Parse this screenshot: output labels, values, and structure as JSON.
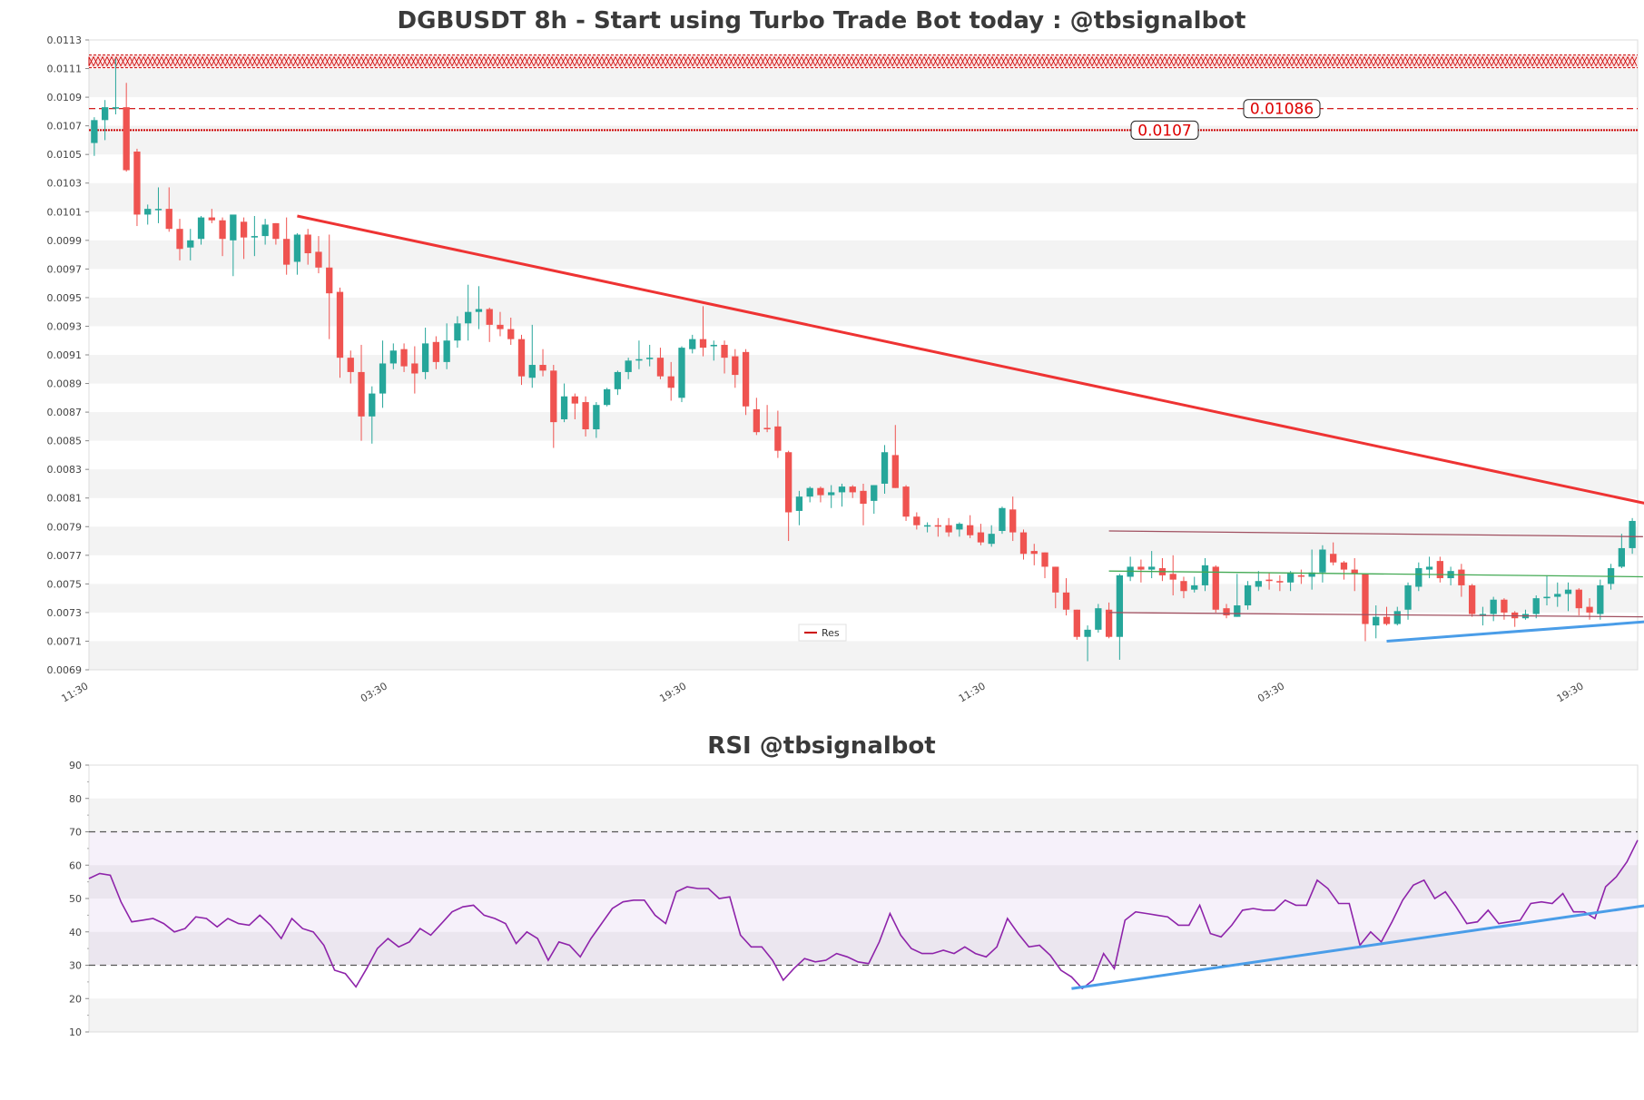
{
  "chart_data": [
    {
      "type": "candlestick",
      "title": "DGBUSDT 8h - Start using Turbo Trade Bot today : @tbsignalbot",
      "ylim": [
        0.0069,
        0.0113
      ],
      "yticks": [
        "0.0069",
        "0.0071",
        "0.0073",
        "0.0075",
        "0.0077",
        "0.0079",
        "0.0081",
        "0.0083",
        "0.0085",
        "0.0087",
        "0.0089",
        "0.0091",
        "0.0093",
        "0.0095",
        "0.0097",
        "0.0099",
        "0.0101",
        "0.0103",
        "0.0105",
        "0.0107",
        "0.0109",
        "0.0111",
        "0.0113"
      ],
      "xticks": [
        {
          "label": "11:30",
          "i": 0
        },
        {
          "label": "03:30",
          "i": 28
        },
        {
          "label": "19:30",
          "i": 56
        },
        {
          "label": "11:30",
          "i": 84
        },
        {
          "label": "03:30",
          "i": 112
        },
        {
          "label": "19:30",
          "i": 140
        }
      ],
      "candles": [
        [
          0.01058,
          0.01074,
          0.01049,
          0.01076
        ],
        [
          0.01074,
          0.01083,
          0.0106,
          0.01088
        ],
        [
          0.01082,
          0.01083,
          0.01078,
          0.01117
        ],
        [
          0.01083,
          0.01039,
          0.01038,
          0.011
        ],
        [
          0.01052,
          0.01008,
          0.01,
          0.01054
        ],
        [
          0.01008,
          0.01012,
          0.01001,
          0.01015
        ],
        [
          0.01012,
          0.01012,
          0.01002,
          0.01027
        ],
        [
          0.01012,
          0.00998,
          0.00996,
          0.01027
        ],
        [
          0.00998,
          0.00984,
          0.00976,
          0.01005
        ],
        [
          0.00985,
          0.0099,
          0.00976,
          0.00998
        ],
        [
          0.00991,
          0.01006,
          0.00987,
          0.01007
        ],
        [
          0.01006,
          0.01004,
          0.01002,
          0.01012
        ],
        [
          0.01004,
          0.00991,
          0.00979,
          0.01006
        ],
        [
          0.0099,
          0.01008,
          0.00965,
          0.01006
        ],
        [
          0.01003,
          0.00992,
          0.00977,
          0.01006
        ],
        [
          0.00992,
          0.00993,
          0.00979,
          0.01007
        ],
        [
          0.00993,
          0.01001,
          0.00987,
          0.01005
        ],
        [
          0.01002,
          0.00991,
          0.00987,
          0.01002
        ],
        [
          0.00991,
          0.00973,
          0.00966,
          0.01006
        ],
        [
          0.00975,
          0.00994,
          0.00966,
          0.00995
        ],
        [
          0.00994,
          0.00981,
          0.00973,
          0.00998
        ],
        [
          0.00982,
          0.00971,
          0.00967,
          0.00993
        ],
        [
          0.00971,
          0.00953,
          0.00921,
          0.00994
        ],
        [
          0.00954,
          0.00908,
          0.00894,
          0.00957
        ],
        [
          0.00908,
          0.00898,
          0.0089,
          0.00913
        ],
        [
          0.00898,
          0.00867,
          0.0085,
          0.00917
        ],
        [
          0.00867,
          0.00883,
          0.00848,
          0.00888
        ],
        [
          0.00883,
          0.00904,
          0.00873,
          0.0092
        ],
        [
          0.00904,
          0.00913,
          0.009,
          0.00918
        ],
        [
          0.00914,
          0.00902,
          0.00898,
          0.00918
        ],
        [
          0.00904,
          0.00897,
          0.00883,
          0.00916
        ],
        [
          0.00898,
          0.00918,
          0.00893,
          0.00929
        ],
        [
          0.00919,
          0.00905,
          0.009,
          0.00923
        ],
        [
          0.00905,
          0.0092,
          0.009,
          0.00932
        ],
        [
          0.0092,
          0.00932,
          0.00915,
          0.00937
        ],
        [
          0.00932,
          0.0094,
          0.0092,
          0.00959
        ],
        [
          0.0094,
          0.00942,
          0.00928,
          0.00958
        ],
        [
          0.00942,
          0.00931,
          0.00919,
          0.00943
        ],
        [
          0.00931,
          0.00928,
          0.00923,
          0.0094
        ],
        [
          0.00928,
          0.00921,
          0.00917,
          0.00936
        ],
        [
          0.00921,
          0.00895,
          0.00889,
          0.00924
        ],
        [
          0.00894,
          0.00903,
          0.00887,
          0.00931
        ],
        [
          0.00903,
          0.00899,
          0.00895,
          0.00914
        ],
        [
          0.00899,
          0.00863,
          0.00845,
          0.00903
        ],
        [
          0.00865,
          0.00881,
          0.00863,
          0.0089
        ],
        [
          0.00881,
          0.00876,
          0.00865,
          0.00883
        ],
        [
          0.00877,
          0.00858,
          0.00853,
          0.00881
        ],
        [
          0.00858,
          0.00875,
          0.00852,
          0.00877
        ],
        [
          0.00875,
          0.00886,
          0.00874,
          0.00887
        ],
        [
          0.00886,
          0.00898,
          0.00882,
          0.00899
        ],
        [
          0.00898,
          0.00906,
          0.00893,
          0.00908
        ],
        [
          0.00906,
          0.00907,
          0.009,
          0.0092
        ],
        [
          0.00907,
          0.00908,
          0.00902,
          0.00917
        ],
        [
          0.00908,
          0.00895,
          0.00893,
          0.00915
        ],
        [
          0.00895,
          0.00887,
          0.00878,
          0.00905
        ],
        [
          0.0088,
          0.00915,
          0.00877,
          0.00916
        ],
        [
          0.00914,
          0.00921,
          0.00911,
          0.00924
        ],
        [
          0.00921,
          0.00915,
          0.00909,
          0.00944
        ],
        [
          0.00916,
          0.00917,
          0.00906,
          0.0092
        ],
        [
          0.00917,
          0.00908,
          0.00897,
          0.0092
        ],
        [
          0.00909,
          0.00896,
          0.00887,
          0.00914
        ],
        [
          0.00912,
          0.00874,
          0.00868,
          0.00914
        ],
        [
          0.00872,
          0.00856,
          0.00854,
          0.0088
        ],
        [
          0.00859,
          0.00858,
          0.00856,
          0.00875
        ],
        [
          0.0086,
          0.00843,
          0.00838,
          0.00871
        ],
        [
          0.00842,
          0.008,
          0.0078,
          0.00843
        ],
        [
          0.00801,
          0.00811,
          0.00791,
          0.00815
        ],
        [
          0.00811,
          0.00817,
          0.00807,
          0.00818
        ],
        [
          0.00817,
          0.00812,
          0.00807,
          0.00818
        ],
        [
          0.00812,
          0.00814,
          0.00803,
          0.00819
        ],
        [
          0.00814,
          0.00818,
          0.00804,
          0.0082
        ],
        [
          0.00818,
          0.00814,
          0.0081,
          0.00819
        ],
        [
          0.00815,
          0.00806,
          0.00791,
          0.0082
        ],
        [
          0.00808,
          0.00819,
          0.00799,
          0.00819
        ],
        [
          0.0082,
          0.00842,
          0.00813,
          0.00847
        ],
        [
          0.0084,
          0.00817,
          0.00817,
          0.00861
        ],
        [
          0.00818,
          0.00797,
          0.00794,
          0.00819
        ],
        [
          0.00797,
          0.00791,
          0.00788,
          0.008
        ],
        [
          0.00791,
          0.00791,
          0.00786,
          0.00793
        ],
        [
          0.00791,
          0.0079,
          0.00783,
          0.00796
        ],
        [
          0.00791,
          0.00786,
          0.00783,
          0.00796
        ],
        [
          0.00788,
          0.00792,
          0.00783,
          0.00793
        ],
        [
          0.00791,
          0.00784,
          0.00782,
          0.00798
        ],
        [
          0.00786,
          0.00779,
          0.00777,
          0.00792
        ],
        [
          0.00778,
          0.00785,
          0.00776,
          0.00791
        ],
        [
          0.00787,
          0.00803,
          0.00785,
          0.00804
        ],
        [
          0.00802,
          0.00786,
          0.0078,
          0.00811
        ],
        [
          0.00786,
          0.00771,
          0.00767,
          0.00788
        ],
        [
          0.00773,
          0.00771,
          0.00763,
          0.00778
        ],
        [
          0.00772,
          0.00762,
          0.00754,
          0.00772
        ],
        [
          0.00762,
          0.00744,
          0.00733,
          0.00762
        ],
        [
          0.00744,
          0.00732,
          0.00728,
          0.00754
        ],
        [
          0.00732,
          0.00713,
          0.00711,
          0.00732
        ],
        [
          0.00713,
          0.00718,
          0.00696,
          0.00721
        ],
        [
          0.00718,
          0.00733,
          0.00716,
          0.00736
        ],
        [
          0.00732,
          0.00713,
          0.00712,
          0.00737
        ],
        [
          0.00713,
          0.00756,
          0.00697,
          0.00757
        ],
        [
          0.00755,
          0.00762,
          0.00752,
          0.00769
        ],
        [
          0.00762,
          0.0076,
          0.00751,
          0.00767
        ],
        [
          0.0076,
          0.00762,
          0.00754,
          0.00773
        ],
        [
          0.00761,
          0.00756,
          0.00752,
          0.00768
        ],
        [
          0.00757,
          0.00753,
          0.00742,
          0.0077
        ],
        [
          0.00752,
          0.00745,
          0.0074,
          0.00755
        ],
        [
          0.00746,
          0.00749,
          0.00744,
          0.00755
        ],
        [
          0.00749,
          0.00763,
          0.00745,
          0.00768
        ],
        [
          0.00762,
          0.00732,
          0.0073,
          0.00763
        ],
        [
          0.00733,
          0.00728,
          0.00726,
          0.00736
        ],
        [
          0.00727,
          0.00735,
          0.00727,
          0.00757
        ],
        [
          0.00735,
          0.00749,
          0.00732,
          0.00752
        ],
        [
          0.00748,
          0.00752,
          0.00745,
          0.00759
        ],
        [
          0.00753,
          0.00752,
          0.00746,
          0.00758
        ],
        [
          0.00752,
          0.00751,
          0.00745,
          0.00756
        ],
        [
          0.00751,
          0.00758,
          0.00745,
          0.00759
        ],
        [
          0.00756,
          0.00755,
          0.0075,
          0.0076
        ],
        [
          0.00755,
          0.00758,
          0.00746,
          0.00774
        ],
        [
          0.00758,
          0.00774,
          0.00751,
          0.00777
        ],
        [
          0.00771,
          0.00765,
          0.00763,
          0.00779
        ],
        [
          0.00765,
          0.0076,
          0.00753,
          0.00766
        ],
        [
          0.0076,
          0.00757,
          0.00745,
          0.00768
        ],
        [
          0.00757,
          0.00722,
          0.0071,
          0.00757
        ],
        [
          0.00721,
          0.00727,
          0.00712,
          0.00735
        ],
        [
          0.00727,
          0.00722,
          0.00721,
          0.00734
        ],
        [
          0.00722,
          0.00731,
          0.00721,
          0.00734
        ],
        [
          0.00732,
          0.00749,
          0.00725,
          0.00751
        ],
        [
          0.00748,
          0.00761,
          0.00745,
          0.00765
        ],
        [
          0.0076,
          0.00762,
          0.00754,
          0.00769
        ],
        [
          0.00766,
          0.00754,
          0.00751,
          0.00769
        ],
        [
          0.00754,
          0.00759,
          0.00749,
          0.00762
        ],
        [
          0.0076,
          0.00749,
          0.00741,
          0.00764
        ],
        [
          0.00749,
          0.00729,
          0.00727,
          0.0075
        ],
        [
          0.00729,
          0.00729,
          0.00721,
          0.00734
        ],
        [
          0.00729,
          0.00739,
          0.00724,
          0.00741
        ],
        [
          0.00739,
          0.0073,
          0.00725,
          0.0074
        ],
        [
          0.0073,
          0.00726,
          0.0072,
          0.00731
        ],
        [
          0.00726,
          0.00729,
          0.00725,
          0.00732
        ],
        [
          0.00729,
          0.0074,
          0.00726,
          0.00742
        ],
        [
          0.0074,
          0.00741,
          0.00735,
          0.00756
        ],
        [
          0.00741,
          0.00743,
          0.00734,
          0.00751
        ],
        [
          0.00743,
          0.00746,
          0.00731,
          0.00751
        ],
        [
          0.00746,
          0.00733,
          0.00728,
          0.00747
        ],
        [
          0.00734,
          0.0073,
          0.00725,
          0.0074
        ],
        [
          0.00729,
          0.00749,
          0.00725,
          0.00753
        ],
        [
          0.0075,
          0.00761,
          0.00746,
          0.00764
        ],
        [
          0.00762,
          0.00775,
          0.00761,
          0.00785
        ],
        [
          0.00775,
          0.00794,
          0.00771,
          0.00796
        ]
      ],
      "colors": {
        "up": "#26a69a",
        "down": "#ef5350"
      },
      "lines": [
        {
          "kind": "resistance-band",
          "y": 0.01115,
          "color": "#cc0000"
        },
        {
          "kind": "dashed",
          "y": 0.01082,
          "color": "#cc0000",
          "label": "0.01086"
        },
        {
          "kind": "dotted",
          "y": 0.01067,
          "color": "#cc0000",
          "label": "0.0107"
        },
        {
          "kind": "trend",
          "from": [
            19,
            0.01007
          ],
          "to": [
            146,
            0.00805
          ],
          "color": "#ee3333"
        },
        {
          "kind": "trend",
          "from": [
            95,
            0.00787
          ],
          "to": [
            145,
            0.00783
          ],
          "color": "#a05060"
        },
        {
          "kind": "trend",
          "from": [
            95,
            0.00759
          ],
          "to": [
            145,
            0.00755
          ],
          "color": "#44aa55"
        },
        {
          "kind": "trend",
          "from": [
            95,
            0.0073
          ],
          "to": [
            145,
            0.00727
          ],
          "color": "#a05060"
        },
        {
          "kind": "trend",
          "from": [
            121,
            0.0071
          ],
          "to": [
            146,
            0.00724
          ],
          "color": "#4a9de8"
        }
      ],
      "legend": {
        "label": "Res",
        "color": "#cc0000",
        "position": "bottom-center"
      }
    },
    {
      "type": "line",
      "title": "RSI @tbsignalbot",
      "ylim": [
        10,
        90
      ],
      "yticks": [
        "10",
        "20",
        "30",
        "40",
        "50",
        "60",
        "70",
        "80",
        "90"
      ],
      "bands": [
        30,
        70
      ],
      "series": [
        {
          "color": "#8e24aa",
          "values": [
            56,
            57.5,
            57,
            49,
            43,
            43.5,
            44,
            42.5,
            40,
            41,
            44.5,
            44,
            41.5,
            44,
            42.5,
            42,
            45,
            42,
            38,
            44,
            41,
            40,
            36,
            28.5,
            27.5,
            23.5,
            29,
            35,
            38,
            35.5,
            37,
            41,
            39,
            42.5,
            46,
            47.5,
            48,
            45,
            44,
            42.5,
            36.5,
            40,
            38,
            31.5,
            37,
            36,
            32.5,
            38,
            42.5,
            47,
            49,
            49.5,
            49.5,
            45,
            42.5,
            52,
            53.5,
            53,
            53,
            50,
            50.5,
            39,
            35.5,
            35.5,
            31.5,
            25.5,
            29,
            32,
            31,
            31.5,
            33.5,
            32.5,
            31,
            30.5,
            37,
            45.5,
            39,
            35,
            33.5,
            33.5,
            34.5,
            33.5,
            35.5,
            33.5,
            32.5,
            35.5,
            44,
            39.5,
            35.5,
            36,
            33,
            28.5,
            26.5,
            23,
            25.5,
            33.5,
            29,
            43.5,
            46,
            45.5,
            45,
            44.5,
            42,
            42,
            48,
            39.5,
            38.5,
            42,
            46.5,
            47,
            46.5,
            46.5,
            49.5,
            48,
            48,
            55.5,
            53,
            48.5,
            48.5,
            36,
            40,
            37,
            43,
            49.5,
            54,
            55.5,
            50,
            52,
            47.5,
            42.5,
            43,
            46.5,
            42.5,
            43,
            43.5,
            48.5,
            49,
            48.5,
            51.5,
            46,
            46,
            44,
            53.5,
            56.5,
            61,
            67.5
          ]
        }
      ],
      "trend": {
        "from": [
          92,
          23
        ],
        "to": [
          146,
          48
        ],
        "color": "#4a9de8"
      }
    }
  ]
}
